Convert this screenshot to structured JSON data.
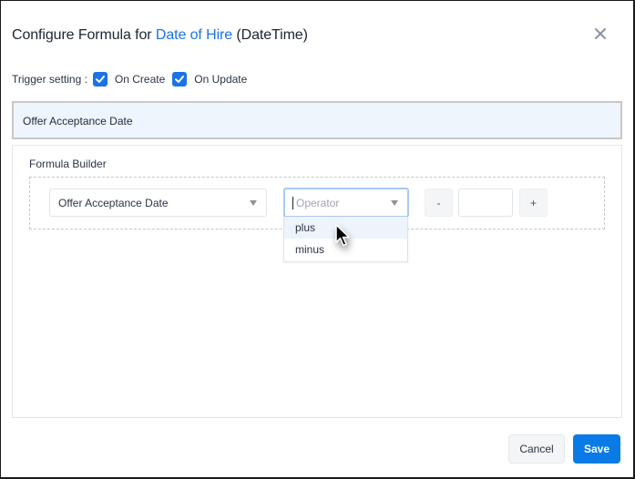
{
  "dialog": {
    "title_prefix": "Configure Formula for",
    "title_field": "Date of Hire",
    "title_type": "(DateTime)",
    "close_icon": "close-icon"
  },
  "trigger": {
    "label": "Trigger setting :",
    "options": [
      {
        "label": "On Create",
        "checked": true
      },
      {
        "label": "On Update",
        "checked": true
      }
    ]
  },
  "formula": {
    "expression": "Offer Acceptance Date"
  },
  "builder": {
    "label": "Formula Builder",
    "field_select": {
      "value": "Offer Acceptance Date"
    },
    "operator_select": {
      "placeholder": "Operator",
      "options": [
        "plus",
        "minus"
      ],
      "hovered": "plus"
    },
    "decrement_label": "-",
    "increment_label": "+",
    "number_value": ""
  },
  "footer": {
    "cancel_label": "Cancel",
    "save_label": "Save"
  },
  "colors": {
    "accent": "#1a73e8",
    "save": "#0a7be6",
    "formula_bg": "#eef5fd"
  }
}
